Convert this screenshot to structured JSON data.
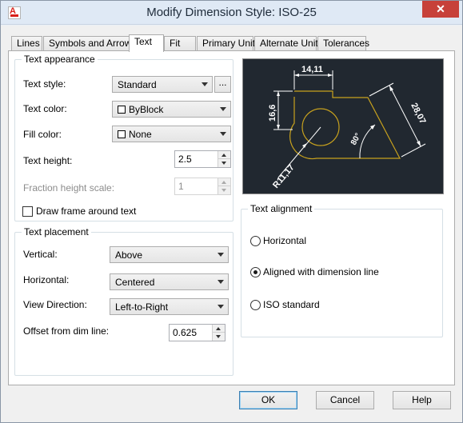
{
  "window": {
    "title": "Modify Dimension Style: ISO-25",
    "close_glyph": "✕",
    "app_icon_letter": "A"
  },
  "tabs": [
    "Lines",
    "Symbols and Arrows",
    "Text",
    "Fit",
    "Primary Units",
    "Alternate Units",
    "Tolerances"
  ],
  "active_tab": "Text",
  "text_appearance": {
    "title": "Text appearance",
    "text_style_label": "Text style:",
    "text_style_value": "Standard",
    "browse_label": "...",
    "text_color_label": "Text color:",
    "text_color_value": "ByBlock",
    "fill_color_label": "Fill color:",
    "fill_color_value": "None",
    "text_height_label": "Text height:",
    "text_height_value": "2.5",
    "fraction_label": "Fraction height scale:",
    "fraction_value": "1",
    "draw_frame_label": "Draw frame around text"
  },
  "text_placement": {
    "title": "Text placement",
    "vertical_label": "Vertical:",
    "vertical_value": "Above",
    "horizontal_label": "Horizontal:",
    "horizontal_value": "Centered",
    "view_direction_label": "View Direction:",
    "view_direction_value": "Left-to-Right",
    "offset_label": "Offset from dim line:",
    "offset_value": "0.625"
  },
  "preview": {
    "dim_top": "14,11",
    "dim_left": "16,6",
    "dim_right": "28,07",
    "dim_angle": "80°",
    "dim_radius": "R11,17",
    "bg_color": "#212830",
    "geometry_color": "#c8a21e",
    "dim_color": "#ffffff"
  },
  "text_alignment": {
    "title": "Text alignment",
    "options": [
      "Horizontal",
      "Aligned with dimension line",
      "ISO standard"
    ],
    "selected": "Aligned with dimension line"
  },
  "buttons": {
    "ok": "OK",
    "cancel": "Cancel",
    "help": "Help"
  }
}
